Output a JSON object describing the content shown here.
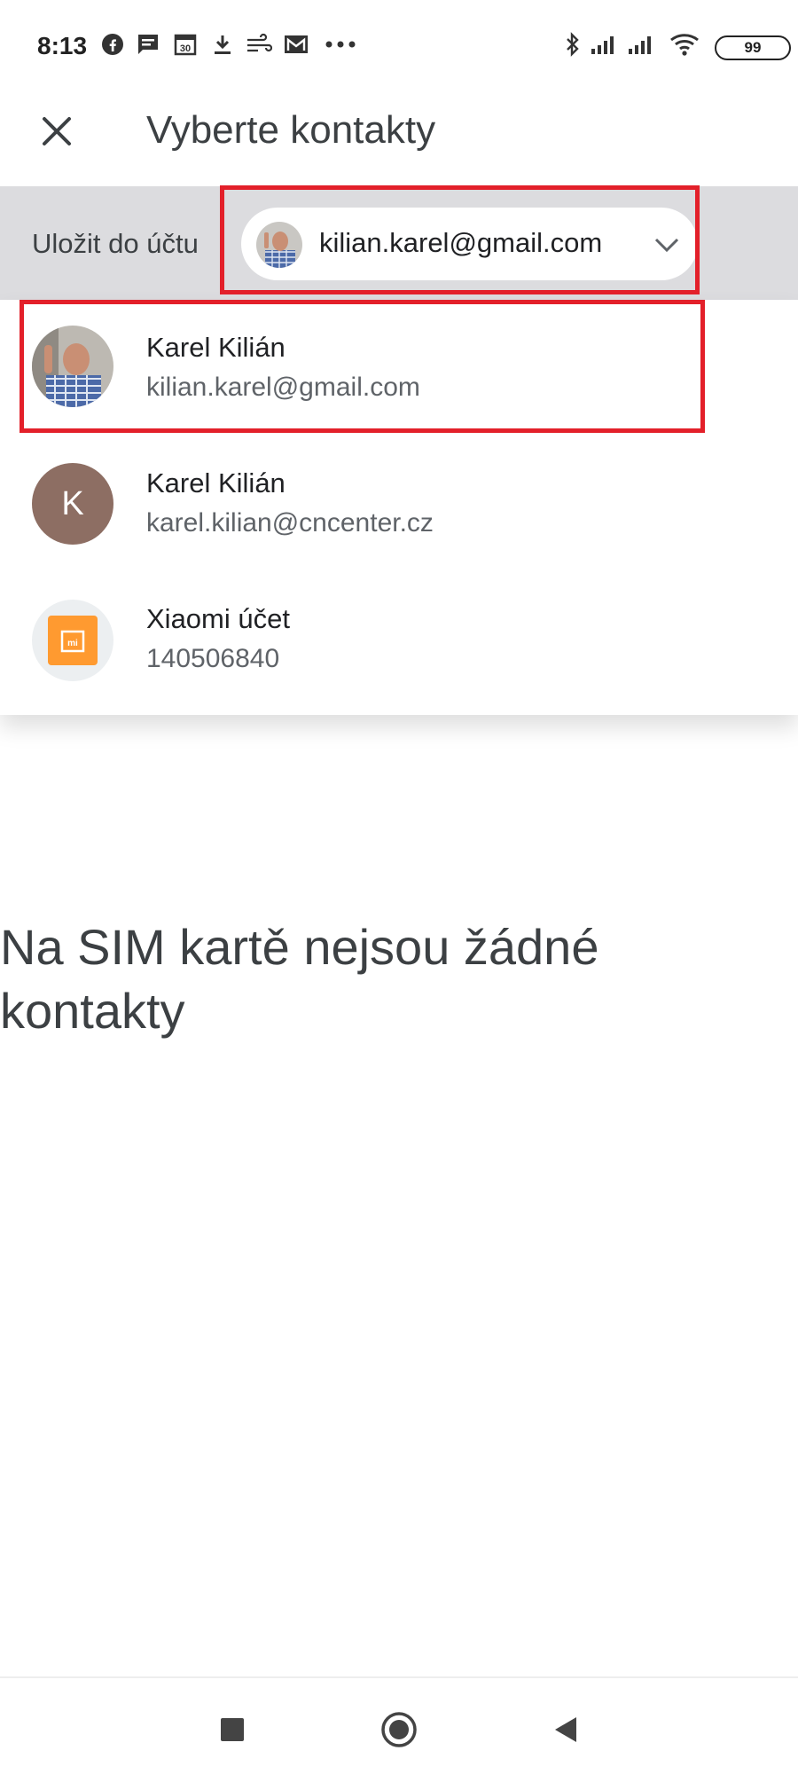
{
  "status_bar": {
    "time": "8:13",
    "icons": [
      "facebook-icon",
      "message-icon",
      "calendar-icon",
      "download-icon",
      "wind-icon",
      "gmail-icon",
      "more-dots-icon"
    ],
    "right_icons": [
      "bluetooth-icon",
      "signal-icon",
      "signal-icon",
      "wifi-icon"
    ],
    "battery": "99"
  },
  "app_bar": {
    "title": "Vyberte kontakty",
    "close_icon": "close-icon"
  },
  "account_selector": {
    "label": "Uložit do účtu",
    "selected_email": "kilian.karel@gmail.com",
    "chevron_icon": "chevron-down-icon"
  },
  "accounts": [
    {
      "name": "Karel Kilián",
      "sub": "kilian.karel@gmail.com",
      "avatar": "photo"
    },
    {
      "name": "Karel Kilián",
      "sub": "karel.kilian@cncenter.cz",
      "avatar_letter": "K",
      "avatar_color": "#8d6e63"
    },
    {
      "name": "Xiaomi účet",
      "sub": "140506840",
      "avatar": "xiaomi-logo",
      "avatar_color": "#ff9a30"
    }
  ],
  "empty_message": {
    "line1": "Na SIM kartě nejsou žádné",
    "line2": "kontakty"
  },
  "colors": {
    "highlight": "#e3202a",
    "strip_bg": "#dcdcdf"
  },
  "nav_bar": {
    "icons": [
      "recents-square-icon",
      "home-circle-icon",
      "back-triangle-icon"
    ]
  }
}
